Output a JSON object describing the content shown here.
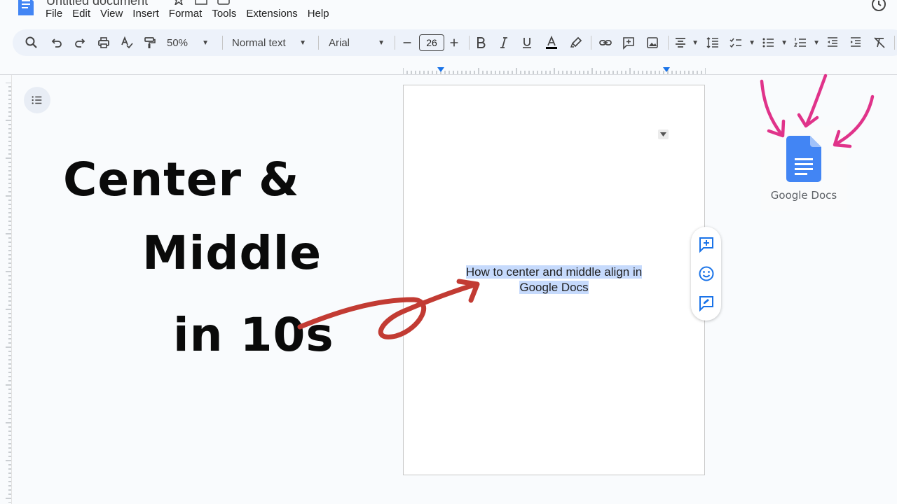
{
  "app": {
    "title": "Untitled document"
  },
  "menu": [
    "File",
    "Edit",
    "View",
    "Insert",
    "Format",
    "Tools",
    "Extensions",
    "Help"
  ],
  "toolbar": {
    "zoom": "50%",
    "style": "Normal text",
    "font": "Arial",
    "font_size": "26"
  },
  "overlay": {
    "line1": "Center &",
    "line2": "Middle",
    "line3": "in 10s"
  },
  "document": {
    "selected_text_line1": "How to center and middle align in",
    "selected_text_line2": "Google Docs"
  },
  "logo": {
    "caption": "Google Docs"
  },
  "colors": {
    "accent_blue": "#4285f4",
    "selection": "#c6dafc",
    "arrow_red": "#c23b33",
    "arrow_pink": "#e0338a",
    "toolbar_bg": "#edf2fa"
  },
  "icons": [
    "docs-logo-icon",
    "star-icon",
    "folder-icon",
    "cloud-icon",
    "history-icon",
    "search-icon",
    "undo-icon",
    "redo-icon",
    "print-icon",
    "spellcheck-icon",
    "paint-format-icon",
    "bold-icon",
    "italic-icon",
    "underline-icon",
    "text-color-icon",
    "highlight-icon",
    "link-icon",
    "add-comment-icon",
    "image-icon",
    "align-icon",
    "line-spacing-icon",
    "checklist-icon",
    "bullet-list-icon",
    "numbered-list-icon",
    "decrease-indent-icon",
    "increase-indent-icon",
    "clear-formatting-icon",
    "outline-icon",
    "emoji-icon",
    "suggest-edits-icon"
  ]
}
